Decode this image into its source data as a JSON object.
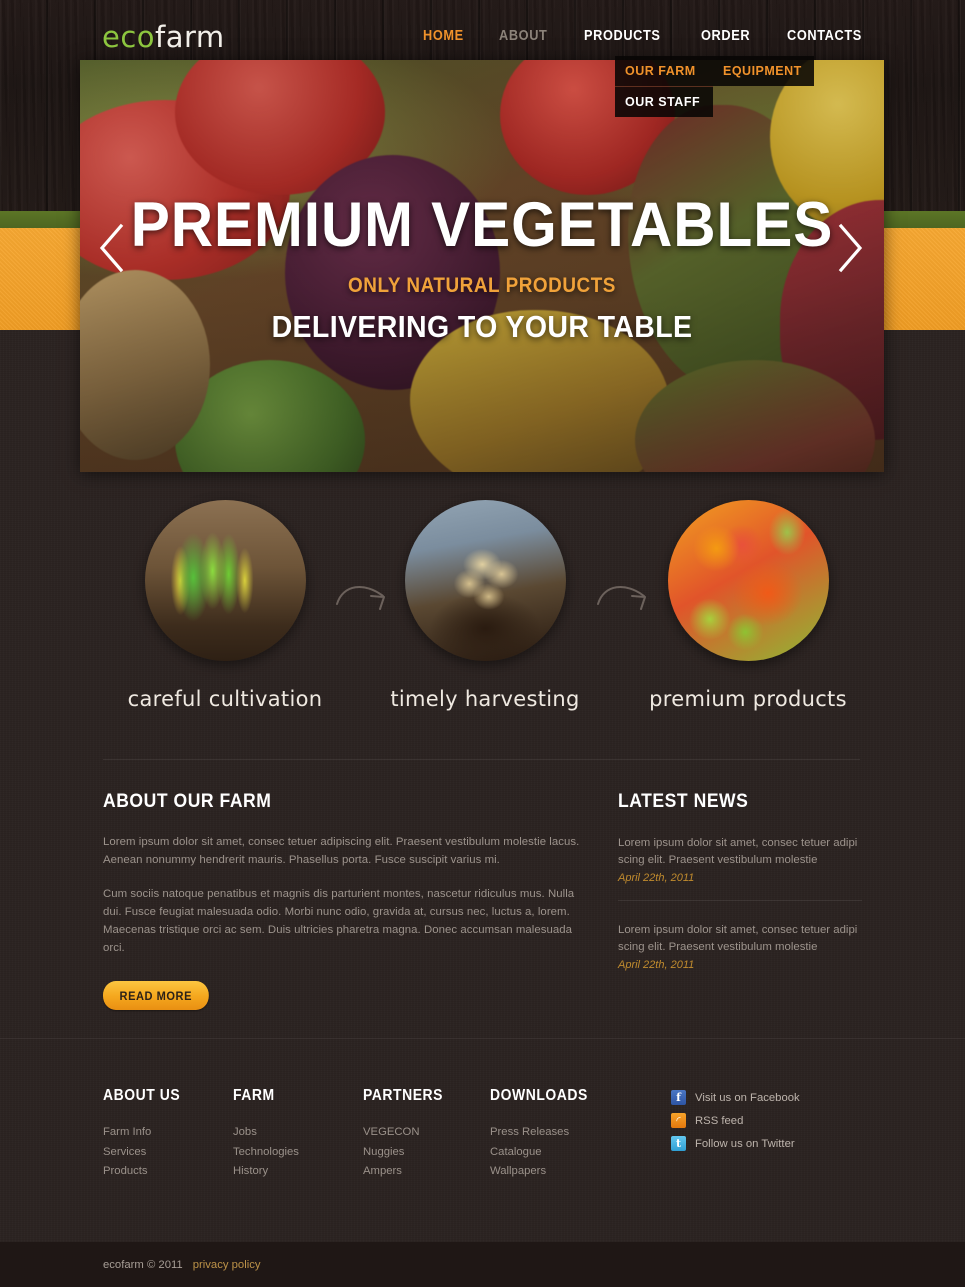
{
  "brand": {
    "logo_eco": "eco",
    "logo_farm": "farm"
  },
  "nav": {
    "items": [
      {
        "label": "HOME",
        "state": "active"
      },
      {
        "label": "ABOUT",
        "state": "hovered"
      },
      {
        "label": "PRODUCTS",
        "state": "normal"
      },
      {
        "label": "ORDER",
        "state": "normal"
      },
      {
        "label": "CONTACTS",
        "state": "normal"
      }
    ],
    "dropdown_about": [
      {
        "label": "OUR FARM",
        "state": "highlight"
      },
      {
        "label": "OUR STAFF",
        "state": "normal"
      }
    ],
    "dropdown_second": [
      {
        "label": "EQUIPMENT",
        "state": "highlight"
      }
    ]
  },
  "hero": {
    "title": "PREMIUM VEGETABLES",
    "subtitle": "ONLY NATURAL PRODUCTS",
    "tagline": "DELIVERING TO YOUR TABLE",
    "prev_icon": "chevron-left-icon",
    "next_icon": "chevron-right-icon"
  },
  "features": [
    {
      "label": "careful cultivation",
      "image": "sprouts-in-soil-photo"
    },
    {
      "label": "timely harvesting",
      "image": "hands-holding-potatoes-photo"
    },
    {
      "label": "premium products",
      "image": "assorted-vegetables-photo"
    }
  ],
  "about": {
    "title": "ABOUT OUR FARM",
    "paragraphs": [
      "Lorem ipsum dolor sit amet, consec tetuer adipiscing elit. Praesent vestibulum molestie lacus. Aenean nonummy hendrerit mauris. Phasellus porta. Fusce suscipit varius mi.",
      "Cum sociis natoque penatibus et magnis dis parturient montes, nascetur ridiculus mus. Nulla dui. Fusce feugiat malesuada odio. Morbi nunc odio, gravida at, cursus nec, luctus a, lorem. Maecenas tristique orci ac sem. Duis ultricies pharetra magna. Donec accumsan malesuada orci."
    ],
    "read_more": "READ MORE"
  },
  "news": {
    "title": "LATEST NEWS",
    "items": [
      {
        "text": "Lorem ipsum dolor sit amet, consec tetuer adipi scing elit. Praesent vestibulum molestie",
        "date": "April 22th, 2011"
      },
      {
        "text": "Lorem ipsum dolor sit amet, consec tetuer adipi scing elit. Praesent vestibulum molestie",
        "date": "April 22th, 2011"
      }
    ]
  },
  "footer": {
    "columns": [
      {
        "title": "ABOUT US",
        "links": [
          "Farm  Info",
          "Services",
          "Products"
        ]
      },
      {
        "title": "FARM",
        "links": [
          "Jobs",
          "Technologies",
          "History"
        ]
      },
      {
        "title": "PARTNERS",
        "links": [
          "VEGECON",
          "Nuggies",
          "Ampers"
        ]
      },
      {
        "title": "DOWNLOADS",
        "links": [
          "Press Releases",
          "Catalogue",
          "Wallpapers"
        ]
      }
    ],
    "social": [
      {
        "icon": "facebook-icon",
        "glyph": "f",
        "label": "Visit us on Facebook"
      },
      {
        "icon": "rss-icon",
        "glyph": "◜",
        "label": "RSS feed"
      },
      {
        "icon": "twitter-icon",
        "glyph": "t",
        "label": "Follow us on Twitter"
      }
    ]
  },
  "bottom": {
    "copyright": "ecofarm © 2011",
    "privacy": "privacy policy"
  },
  "colors": {
    "accent_orange": "#f0922b",
    "logo_green": "#8dc63f",
    "band_green": "#4e6621",
    "band_orange": "#f4a12c",
    "page_bg": "#2b2220",
    "date_gold": "#c08b2e"
  }
}
